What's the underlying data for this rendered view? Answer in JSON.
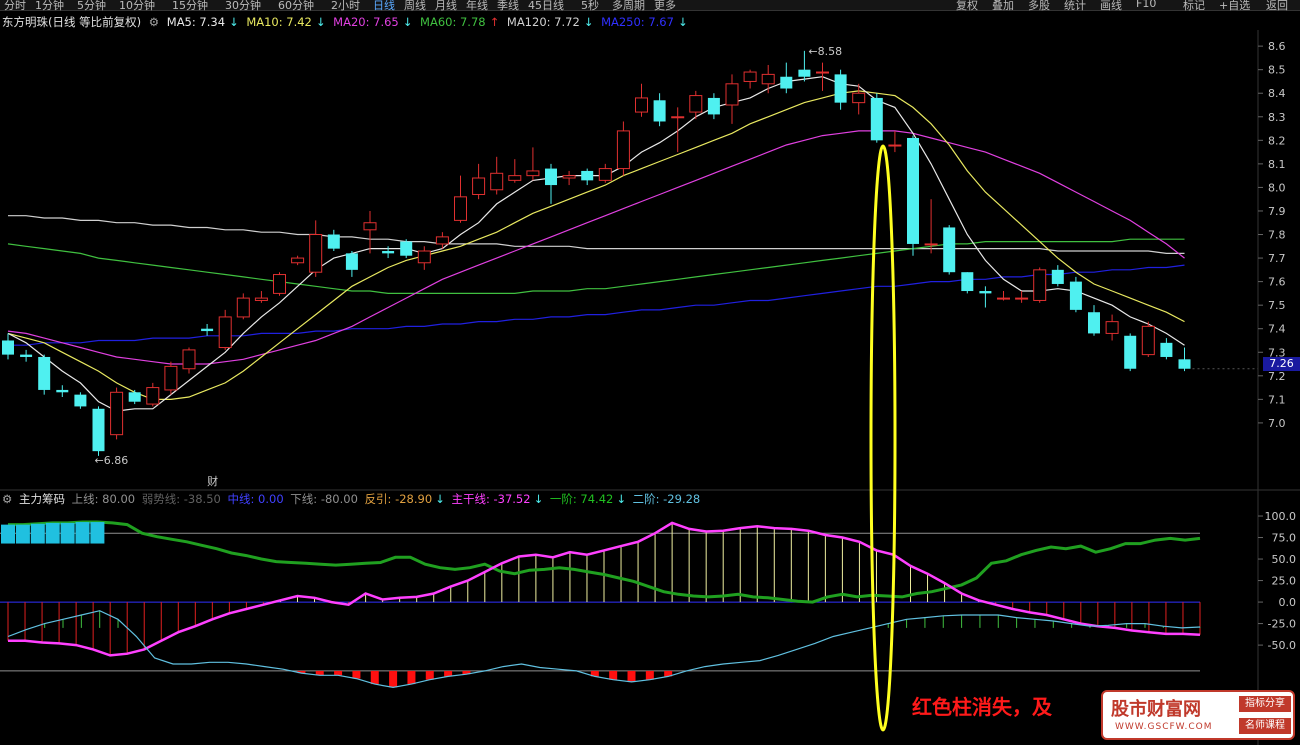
{
  "toolbar": {
    "periods": [
      "分时",
      "1分钟",
      "5分钟",
      "10分钟",
      "15分钟",
      "30分钟",
      "60分钟",
      "2小时",
      "日线",
      "周线",
      "月线",
      "年线",
      "季线",
      "45日线",
      "5秒",
      "多周期",
      "更多"
    ],
    "active": "日线",
    "right": [
      "复权",
      "叠加",
      "多股",
      "统计",
      "画线",
      "F10",
      "标记",
      "+自选",
      "返回"
    ]
  },
  "main_legend": {
    "title": "东方明珠(日线 等比前复权)",
    "ma5": "MA5: 7.34",
    "ma10": "MA10: 7.42",
    "ma20": "MA20: 7.65",
    "ma60": "MA60: 7.78",
    "ma120": "MA120: 7.72",
    "ma250": "MA250: 7.67"
  },
  "indicator_legend": {
    "title": "主力筹码",
    "upper": "上线: 80.00",
    "weak": "弱势线: -38.50",
    "mid": "中线: 0.00",
    "lower": "下线: -80.00",
    "rebound": "反引: -28.90",
    "main": "主干线: -37.52",
    "first": "一阶: 74.42",
    "second": "二阶: -29.28"
  },
  "colors": {
    "up": "#e03030",
    "down": "#4ff0f0",
    "ma5": "#e8e8e8",
    "ma10": "#e8e860",
    "ma20": "#e040e0",
    "ma60": "#40c040",
    "ma120": "#d0d0d0",
    "ma250": "#2020e0",
    "main_line": "#ff40ff",
    "first_line": "#20a020",
    "second_line": "#60c0e0"
  },
  "annotations": {
    "high_label": "8.58",
    "low_label": "6.86",
    "fin_marker": "财",
    "current_price": "7.26",
    "callout": "红色柱消失，及"
  },
  "watermark": {
    "title": "股市财富网",
    "url": "WWW.GSCFW.COM",
    "badge1": "指标分享",
    "badge2": "名师课程"
  },
  "chart_data": [
    {
      "type": "candlestick",
      "y_ticks": [
        7.0,
        7.1,
        7.2,
        7.3,
        7.4,
        7.5,
        7.6,
        7.7,
        7.8,
        7.9,
        8.0,
        8.1,
        8.2,
        8.3,
        8.4,
        8.5,
        8.6
      ],
      "ylim": [
        6.8,
        8.66
      ],
      "candles": [
        [
          7.35,
          7.29,
          7.38,
          7.27
        ],
        [
          7.29,
          7.28,
          7.31,
          7.26
        ],
        [
          7.28,
          7.14,
          7.29,
          7.12
        ],
        [
          7.14,
          7.13,
          7.16,
          7.11
        ],
        [
          7.12,
          7.07,
          7.13,
          7.06
        ],
        [
          7.06,
          6.88,
          7.07,
          6.86
        ],
        [
          6.95,
          7.13,
          7.15,
          6.93
        ],
        [
          7.13,
          7.09,
          7.14,
          7.08
        ],
        [
          7.08,
          7.15,
          7.17,
          7.07
        ],
        [
          7.14,
          7.24,
          7.26,
          7.12
        ],
        [
          7.23,
          7.31,
          7.32,
          7.21
        ],
        [
          7.4,
          7.39,
          7.42,
          7.37
        ],
        [
          7.32,
          7.45,
          7.48,
          7.31
        ],
        [
          7.45,
          7.53,
          7.55,
          7.44
        ],
        [
          7.52,
          7.53,
          7.56,
          7.51
        ],
        [
          7.55,
          7.63,
          7.64,
          7.54
        ],
        [
          7.68,
          7.7,
          7.71,
          7.67
        ],
        [
          7.64,
          7.8,
          7.86,
          7.62
        ],
        [
          7.8,
          7.74,
          7.82,
          7.73
        ],
        [
          7.72,
          7.65,
          7.73,
          7.62
        ],
        [
          7.82,
          7.85,
          7.9,
          7.72
        ],
        [
          7.73,
          7.72,
          7.75,
          7.7
        ],
        [
          7.77,
          7.71,
          7.78,
          7.7
        ],
        [
          7.68,
          7.73,
          7.75,
          7.65
        ],
        [
          7.76,
          7.79,
          7.81,
          7.74
        ],
        [
          7.86,
          7.96,
          8.05,
          7.85
        ],
        [
          7.97,
          8.04,
          8.1,
          7.95
        ],
        [
          7.99,
          8.06,
          8.13,
          7.97
        ],
        [
          8.03,
          8.05,
          8.12,
          8.02
        ],
        [
          8.05,
          8.07,
          8.17,
          8.03
        ],
        [
          8.08,
          8.01,
          8.1,
          7.93
        ],
        [
          8.04,
          8.05,
          8.07,
          8.01
        ],
        [
          8.07,
          8.03,
          8.08,
          8.01
        ],
        [
          8.03,
          8.08,
          8.1,
          8.02
        ],
        [
          8.08,
          8.24,
          8.28,
          8.05
        ],
        [
          8.32,
          8.38,
          8.44,
          8.3
        ],
        [
          8.37,
          8.28,
          8.4,
          8.26
        ],
        [
          8.3,
          8.3,
          8.34,
          8.15
        ],
        [
          8.32,
          8.39,
          8.41,
          8.29
        ],
        [
          8.38,
          8.31,
          8.4,
          8.29
        ],
        [
          8.35,
          8.44,
          8.48,
          8.27
        ],
        [
          8.45,
          8.49,
          8.5,
          8.42
        ],
        [
          8.44,
          8.48,
          8.52,
          8.4
        ],
        [
          8.47,
          8.42,
          8.53,
          8.4
        ],
        [
          8.5,
          8.47,
          8.58,
          8.45
        ],
        [
          8.49,
          8.49,
          8.53,
          8.41
        ],
        [
          8.48,
          8.36,
          8.5,
          8.33
        ],
        [
          8.36,
          8.4,
          8.44,
          8.31
        ],
        [
          8.38,
          8.2,
          8.4,
          8.19
        ],
        [
          8.18,
          8.18,
          8.24,
          8.15
        ],
        [
          8.21,
          7.76,
          8.22,
          7.71
        ],
        [
          7.76,
          7.76,
          7.95,
          7.72
        ],
        [
          7.83,
          7.64,
          7.84,
          7.63
        ],
        [
          7.64,
          7.56,
          7.64,
          7.55
        ],
        [
          7.56,
          7.55,
          7.58,
          7.49
        ],
        [
          7.53,
          7.53,
          7.56,
          7.52
        ],
        [
          7.53,
          7.53,
          7.56,
          7.51
        ],
        [
          7.52,
          7.65,
          7.66,
          7.51
        ],
        [
          7.65,
          7.59,
          7.67,
          7.58
        ],
        [
          7.6,
          7.48,
          7.62,
          7.47
        ],
        [
          7.47,
          7.38,
          7.5,
          7.37
        ],
        [
          7.38,
          7.43,
          7.46,
          7.35
        ],
        [
          7.37,
          7.23,
          7.38,
          7.22
        ],
        [
          7.29,
          7.41,
          7.43,
          7.28
        ],
        [
          7.34,
          7.28,
          7.36,
          7.27
        ],
        [
          7.27,
          7.23,
          7.32,
          7.22
        ]
      ],
      "ma5": [
        7.38,
        7.34,
        7.28,
        7.22,
        7.17,
        7.09,
        7.05,
        7.06,
        7.06,
        7.12,
        7.18,
        7.24,
        7.3,
        7.38,
        7.45,
        7.51,
        7.58,
        7.65,
        7.7,
        7.72,
        7.74,
        7.74,
        7.74,
        7.72,
        7.74,
        7.8,
        7.85,
        7.93,
        7.98,
        8.03,
        8.04,
        8.05,
        8.05,
        8.05,
        8.09,
        8.15,
        8.19,
        8.24,
        8.3,
        8.34,
        8.36,
        8.38,
        8.42,
        8.45,
        8.46,
        8.47,
        8.44,
        8.43,
        8.37,
        8.34,
        8.23,
        8.1,
        7.95,
        7.8,
        7.69,
        7.61,
        7.56,
        7.56,
        7.57,
        7.56,
        7.53,
        7.5,
        7.45,
        7.42,
        7.38,
        7.33
      ],
      "ma10": [
        7.38,
        7.36,
        7.34,
        7.3,
        7.26,
        7.22,
        7.17,
        7.13,
        7.1,
        7.1,
        7.11,
        7.14,
        7.17,
        7.22,
        7.28,
        7.34,
        7.4,
        7.46,
        7.52,
        7.58,
        7.62,
        7.66,
        7.69,
        7.71,
        7.73,
        7.75,
        7.78,
        7.81,
        7.85,
        7.89,
        7.92,
        7.95,
        7.98,
        8.01,
        8.05,
        8.08,
        8.11,
        8.14,
        8.17,
        8.2,
        8.23,
        8.27,
        8.3,
        8.33,
        8.36,
        8.38,
        8.4,
        8.41,
        8.4,
        8.39,
        8.34,
        8.27,
        8.18,
        8.07,
        7.98,
        7.91,
        7.84,
        7.77,
        7.7,
        7.64,
        7.59,
        7.56,
        7.53,
        7.5,
        7.47,
        7.43
      ],
      "ma20": [
        7.39,
        7.38,
        7.36,
        7.34,
        7.32,
        7.3,
        7.28,
        7.27,
        7.26,
        7.25,
        7.25,
        7.25,
        7.26,
        7.27,
        7.29,
        7.31,
        7.33,
        7.35,
        7.38,
        7.41,
        7.45,
        7.49,
        7.53,
        7.57,
        7.61,
        7.64,
        7.67,
        7.7,
        7.73,
        7.76,
        7.79,
        7.82,
        7.85,
        7.88,
        7.91,
        7.94,
        7.97,
        8.0,
        8.03,
        8.06,
        8.09,
        8.12,
        8.15,
        8.18,
        8.2,
        8.22,
        8.23,
        8.24,
        8.24,
        8.24,
        8.23,
        8.21,
        8.19,
        8.17,
        8.15,
        8.12,
        8.09,
        8.06,
        8.02,
        7.98,
        7.94,
        7.9,
        7.86,
        7.81,
        7.76,
        7.7
      ],
      "ma60": [
        7.76,
        7.75,
        7.74,
        7.73,
        7.72,
        7.7,
        7.69,
        7.68,
        7.67,
        7.66,
        7.65,
        7.64,
        7.63,
        7.62,
        7.61,
        7.6,
        7.59,
        7.58,
        7.57,
        7.56,
        7.56,
        7.55,
        7.55,
        7.55,
        7.55,
        7.55,
        7.55,
        7.55,
        7.55,
        7.56,
        7.56,
        7.56,
        7.57,
        7.57,
        7.58,
        7.59,
        7.6,
        7.61,
        7.62,
        7.63,
        7.64,
        7.65,
        7.66,
        7.67,
        7.68,
        7.69,
        7.7,
        7.71,
        7.72,
        7.73,
        7.74,
        7.75,
        7.76,
        7.76,
        7.77,
        7.77,
        7.77,
        7.77,
        7.77,
        7.77,
        7.77,
        7.77,
        7.78,
        7.78,
        7.78,
        7.78
      ],
      "ma120": [
        7.88,
        7.88,
        7.87,
        7.87,
        7.86,
        7.86,
        7.85,
        7.85,
        7.84,
        7.84,
        7.83,
        7.83,
        7.82,
        7.82,
        7.81,
        7.81,
        7.8,
        7.8,
        7.79,
        7.79,
        7.78,
        7.78,
        7.77,
        7.77,
        7.76,
        7.76,
        7.76,
        7.76,
        7.75,
        7.75,
        7.75,
        7.75,
        7.74,
        7.74,
        7.74,
        7.74,
        7.74,
        7.74,
        7.74,
        7.74,
        7.74,
        7.74,
        7.74,
        7.74,
        7.74,
        7.74,
        7.74,
        7.74,
        7.74,
        7.74,
        7.74,
        7.74,
        7.74,
        7.74,
        7.74,
        7.74,
        7.74,
        7.74,
        7.73,
        7.73,
        7.73,
        7.73,
        7.73,
        7.73,
        7.72,
        7.72
      ],
      "ma250": [
        7.33,
        7.33,
        7.34,
        7.34,
        7.34,
        7.35,
        7.35,
        7.35,
        7.36,
        7.36,
        7.36,
        7.37,
        7.37,
        7.37,
        7.38,
        7.38,
        7.38,
        7.39,
        7.39,
        7.4,
        7.4,
        7.4,
        7.41,
        7.41,
        7.42,
        7.42,
        7.43,
        7.43,
        7.44,
        7.44,
        7.45,
        7.45,
        7.46,
        7.46,
        7.47,
        7.48,
        7.48,
        7.49,
        7.5,
        7.5,
        7.51,
        7.52,
        7.52,
        7.53,
        7.54,
        7.55,
        7.56,
        7.57,
        7.58,
        7.58,
        7.59,
        7.6,
        7.6,
        7.61,
        7.61,
        7.62,
        7.62,
        7.63,
        7.63,
        7.64,
        7.64,
        7.65,
        7.65,
        7.66,
        7.66,
        7.67
      ]
    },
    {
      "type": "line",
      "y_ticks": [
        100.0,
        75.0,
        50.0,
        25.0,
        0.0,
        -25.0,
        -50.0
      ],
      "ylim": [
        -65,
        107
      ],
      "upper": 80,
      "mid": 0,
      "lower": -80,
      "weak": -38.5,
      "main_line": [
        -45,
        -45,
        -47,
        -48,
        -50,
        -55,
        -62,
        -60,
        -55,
        -45,
        -35,
        -28,
        -20,
        -13,
        -8,
        -3,
        2,
        7,
        5,
        0,
        -3,
        10,
        3,
        5,
        6,
        10,
        18,
        25,
        35,
        45,
        53,
        55,
        52,
        58,
        55,
        60,
        65,
        70,
        80,
        92,
        85,
        82,
        83,
        86,
        88,
        86,
        85,
        83,
        78,
        75,
        70,
        60,
        55,
        42,
        33,
        22,
        10,
        2,
        -3,
        -8,
        -12,
        -15,
        -20,
        -25,
        -28,
        -30,
        -33,
        -35,
        -37,
        -37,
        -38
      ],
      "first_line": [
        90,
        90,
        91,
        92,
        92,
        93,
        93,
        92,
        90,
        80,
        76,
        73,
        70,
        66,
        62,
        57,
        54,
        50,
        47,
        46,
        45,
        44,
        43,
        44,
        45,
        46,
        52,
        52,
        44,
        40,
        38,
        40,
        44,
        36,
        33,
        37,
        38,
        40,
        38,
        35,
        32,
        28,
        24,
        18,
        12,
        9,
        7,
        6,
        7,
        9,
        6,
        5,
        3,
        1,
        0,
        6,
        9,
        6,
        8,
        7,
        6,
        10,
        12,
        16,
        20,
        28,
        45,
        48,
        55,
        60,
        64,
        62,
        65,
        58,
        62,
        68,
        68,
        72,
        74,
        72,
        74
      ],
      "second_line": [
        -40,
        -32,
        -25,
        -20,
        -15,
        -10,
        -20,
        -40,
        -65,
        -72,
        -72,
        -70,
        -70,
        -72,
        -75,
        -78,
        -82,
        -84,
        -84,
        -87,
        -92,
        -95,
        -92,
        -88,
        -85,
        -83,
        -80,
        -75,
        -72,
        -76,
        -78,
        -80,
        -85,
        -88,
        -90,
        -88,
        -85,
        -80,
        -75,
        -72,
        -70,
        -68,
        -62,
        -55,
        -48,
        -40,
        -35,
        -30,
        -25,
        -20,
        -18,
        -16,
        -15,
        -15,
        -15,
        -18,
        -20,
        -22,
        -25,
        -28,
        -27,
        -25,
        -25,
        -28,
        -30,
        -29
      ]
    }
  ]
}
